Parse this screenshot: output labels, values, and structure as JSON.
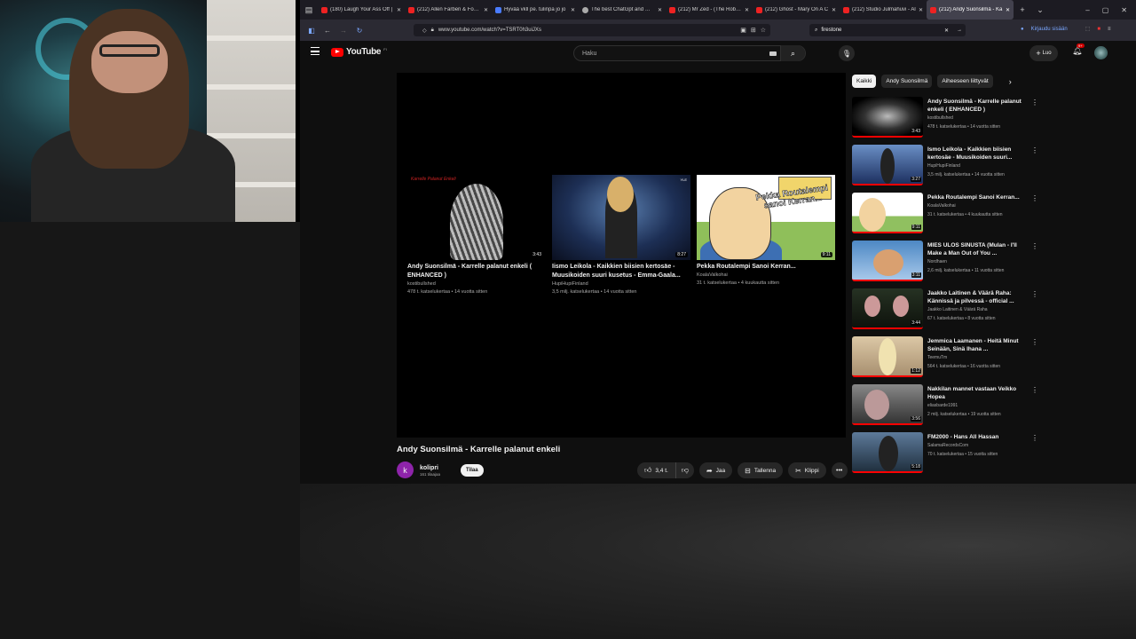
{
  "browser": {
    "tabs": [
      {
        "title": "(180) Laugh Your Ass Off |",
        "fav": "red"
      },
      {
        "title": "(212) Allen Farben & Foote",
        "fav": "red"
      },
      {
        "title": "Hyvää vkll pe. tulinpa jo jo",
        "fav": "blue"
      },
      {
        "title": "The best ChatGpt and Wolc",
        "fav": "gray"
      },
      {
        "title": "(212) Mr Zed - (The Robot)",
        "fav": "red"
      },
      {
        "title": "(212) Ghost - Mary On A C",
        "fav": "red"
      },
      {
        "title": "(212) Studio Julmahuvi - Al",
        "fav": "red"
      },
      {
        "title": "(212) Andy Suonsilmä - Ka",
        "fav": "red"
      }
    ],
    "url": "www.youtube.com/watch?v=TSRT0h3uiJXs",
    "search_ext_label": "firestone",
    "signin_label": "Kirjaudu sisään"
  },
  "youtube": {
    "logo_text": "YouTube",
    "logo_region": "FI",
    "search_placeholder": "Haku",
    "create_label": "Luo",
    "notif_badge": "9+",
    "video_title": "Andy Suonsilmä - Karrelle palanut enkeli",
    "channel": {
      "initial": "k",
      "name": "kolipri",
      "subs": "161 tilaajaa",
      "subscribe": "Tilaa"
    },
    "actions": {
      "likes": "3,4 t.",
      "share": "Jaa",
      "save": "Tallenna",
      "clip": "Klippi"
    },
    "endcards": [
      {
        "title": "Andy Suonsilmä - Karrelle palanut enkeli ( ENHANCED )",
        "channel": "kostibullshed",
        "meta": "478 t. katselukertaa • 14 vuotta sitten",
        "duration": "3:43",
        "thumb_caption": "Karrelle Palanut Enkeli"
      },
      {
        "title": "Iismo Leikola - Kaikkien biisien kertosäe - Muusikoiden suuri kusetus - Emma-Gaala...",
        "channel": "HupiHupiFinland",
        "meta": "3,5 milj. katselukertaa • 14 vuotta sitten",
        "duration": "8:27",
        "thumb_caption": "YLE"
      },
      {
        "title": "Pekka Routalempi Sanoi Kerran...",
        "channel": "KoalaValkohai",
        "meta": "31 t. katselukertaa • 4 kuukautta sitten",
        "duration": "9:11",
        "thumb_caption": "Pekka Routalempi sanoi Kerran..."
      }
    ],
    "chips": [
      "Kaikki",
      "Andy Suonsilmä",
      "Aiheeseen liittyvät"
    ],
    "related": [
      {
        "title": "Andy Suonsilmä - Karrelle palanut enkeli ( ENHANCED )",
        "channel": "kostibullshed",
        "meta": "478 t. katselukertaa • 14 vuotta sitten",
        "duration": "3:43"
      },
      {
        "title": "Ismo Leikola - Kaikkien biisien kertosäe - Muusikoiden suuri...",
        "channel": "HupiHupiFinland",
        "meta": "3,5 milj. katselukertaa • 14 vuotta sitten",
        "duration": "3:27"
      },
      {
        "title": "Pekka Routalempi Sanoi Kerran...",
        "channel": "KoalaValkohai",
        "meta": "31 t. katselukertaa • 4 kuukautta sitten",
        "duration": "9:11"
      },
      {
        "title": "MIES ULOS SINUSTA (Mulan - I'll Make a Man Out of You ...",
        "channel": "Nordhaen",
        "meta": "2,6 milj. katselukertaa • 11 vuotta sitten",
        "duration": "3:11"
      },
      {
        "title": "Jaakko Laitinen & Väärä Raha: Kännissä ja pilvessä - official ...",
        "channel": "Jaakko Laitinen & Väärä Raha",
        "meta": "67 t. katselukertaa • 8 vuotta sitten",
        "duration": "3:44"
      },
      {
        "title": "Jemmica Laamanen - Heitä Minut Seinään, Sinä Ihana ...",
        "channel": "TeemuTm",
        "meta": "564 t. katselukertaa • 16 vuotta sitten",
        "duration": "1:12"
      },
      {
        "title": "Nakkilan mannet vastaan Veikko Hopea",
        "channel": "eliasbarde1991",
        "meta": "2 milj. katselukertaa • 19 vuotta sitten",
        "duration": "3:56"
      },
      {
        "title": "FM2000 - Hans All Hassan",
        "channel": "SalamaRecordsCom",
        "meta": "70 t. katselukertaa • 15 vuotta sitten",
        "duration": "5:18"
      }
    ]
  }
}
